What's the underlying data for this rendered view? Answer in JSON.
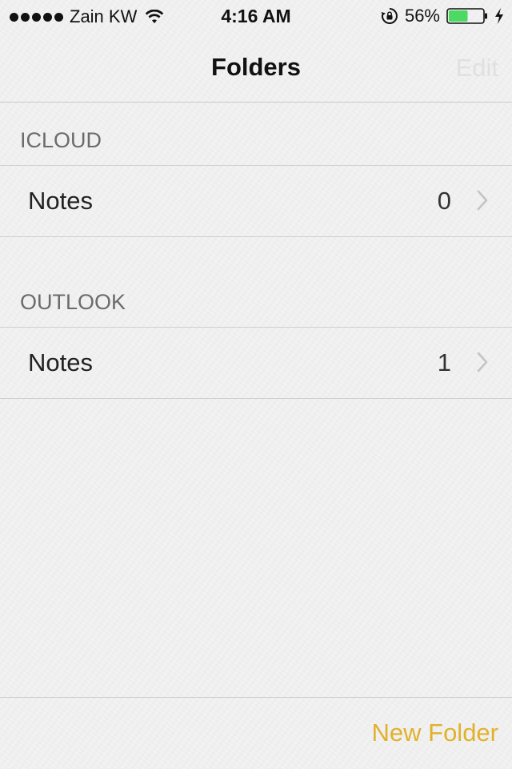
{
  "status_bar": {
    "carrier": "Zain KW",
    "time": "4:16 AM",
    "battery_percent": "56%",
    "battery_level": 0.56,
    "signal_bars": 5
  },
  "nav": {
    "title": "Folders",
    "edit_label": "Edit"
  },
  "sections": [
    {
      "header": "ICLOUD",
      "folders": [
        {
          "name": "Notes",
          "count": "0"
        }
      ]
    },
    {
      "header": "OUTLOOK",
      "folders": [
        {
          "name": "Notes",
          "count": "1"
        }
      ]
    }
  ],
  "toolbar": {
    "new_folder_label": "New Folder"
  },
  "colors": {
    "accent": "#e1b12c",
    "disabled": "#e0e0e0",
    "battery_fill": "#4cd964"
  },
  "icons": [
    "wifi-icon",
    "orientation-lock-icon",
    "battery-icon",
    "charging-bolt-icon",
    "chevron-right-icon"
  ]
}
